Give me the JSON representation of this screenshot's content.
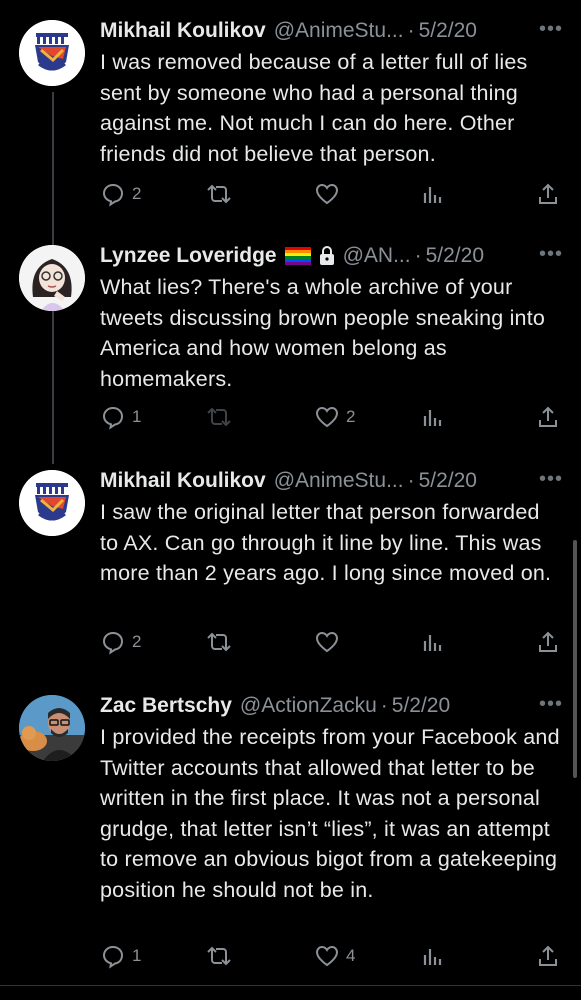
{
  "tweets": [
    {
      "name": "Mikhail Koulikov",
      "handle": "@AnimeStu...",
      "date": "5/2/20",
      "text": "I was removed because of a letter full of lies sent by someone who had a personal thing against me. Not much I can do here. Other friends did not believe that person.",
      "replies": "2",
      "retweets": "",
      "likes": "",
      "avatar": "shield-logo-avatar"
    },
    {
      "name": "Lynzee Loveridge",
      "handle": "@AN...",
      "date": "5/2/20",
      "text": "What lies? There's a whole archive of your tweets discussing brown people sneaking into America and how women belong as homemakers.",
      "replies": "1",
      "retweets": "",
      "likes": "2",
      "badges": [
        "rainbow-flag-icon",
        "lock-icon"
      ],
      "avatar": "drawn-character-avatar"
    },
    {
      "name": "Mikhail Koulikov",
      "handle": "@AnimeStu...",
      "date": "5/2/20",
      "text": "I saw the original letter that person forwarded to AX. Can go through it line by line. This was more than 2 years ago. I long since moved on.",
      "replies": "2",
      "retweets": "",
      "likes": "",
      "avatar": "shield-logo-avatar"
    },
    {
      "name": "Zac Bertschy",
      "handle": "@ActionZacku",
      "date": "5/2/20",
      "text": "I provided the receipts from your Facebook and Twitter accounts that allowed that letter to be written in the first place. It was not a personal grudge, that letter isn’t “lies”, it was an attempt to remove an obvious bigot from a gatekeeping position he should not be in.",
      "replies": "1",
      "retweets": "",
      "likes": "4",
      "avatar": "photo-avatar"
    }
  ],
  "ui": {
    "more": "•••",
    "dot": "·"
  }
}
